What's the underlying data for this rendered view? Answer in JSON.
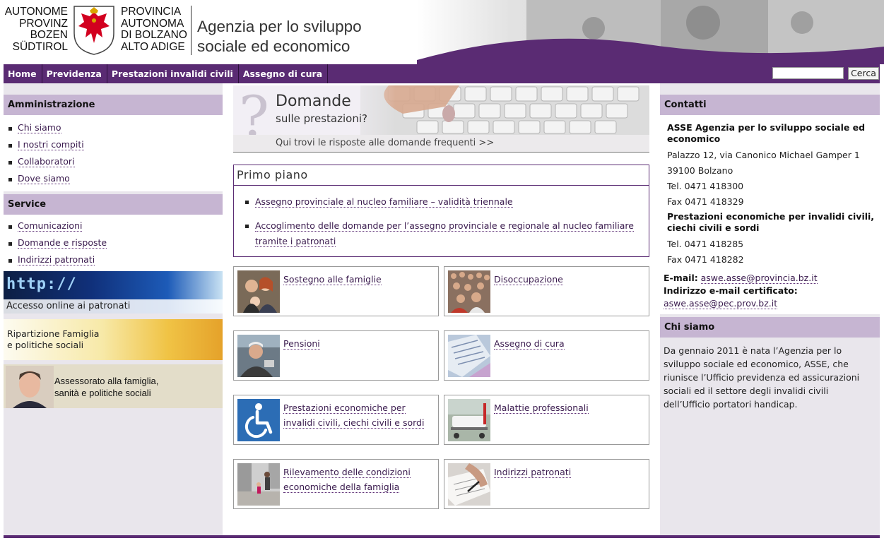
{
  "header": {
    "logo_left_lines": [
      "AUTONOME",
      "PROVINZ",
      "BOZEN",
      "SÜDTIROL"
    ],
    "logo_right_lines": [
      "PROVINCIA",
      "AUTONOMA",
      "DI BOLZANO",
      "ALTO ADIGE"
    ],
    "agency_line1": "Agenzia per lo sviluppo",
    "agency_line2": "sociale ed economico"
  },
  "nav": {
    "items": [
      "Home",
      "Previdenza",
      "Prestazioni invalidi civili",
      "Assegno di cura"
    ],
    "search_value": "",
    "search_button": "Cerca"
  },
  "left": {
    "admin_title": "Amministrazione",
    "admin_links": [
      "Chi siamo",
      "I nostri compiti",
      "Collaboratori",
      "Dove siamo"
    ],
    "service_title": "Service",
    "service_links": [
      "Comunicazioni",
      "Domande e risposte",
      "Indirizzi patronati"
    ],
    "banner_http_text": "http://",
    "banner_http_caption": "Accesso online ai patronati",
    "banner_family_line1": "Ripartizione Famiglia",
    "banner_family_line2": "e politiche sociali",
    "banner_assessor_line1": "Assessorato alla famiglia,",
    "banner_assessor_line2": "sanità e politiche sociali"
  },
  "center": {
    "faq_title": "Domande",
    "faq_sub": "sulle prestazioni?",
    "faq_link": "Qui trovi le risposte alle domande frequenti >>",
    "primo_title": "Primo piano",
    "primo_items": [
      "Assegno provinciale al nucleo familiare – validità triennale",
      "Accoglimento delle domande per l’assegno provinciale e regionale al nucleo familiare tramite i patronati"
    ],
    "tiles": [
      {
        "label": "Sostegno alle famiglie"
      },
      {
        "label": "Disoccupazione"
      },
      {
        "label": "Pensioni"
      },
      {
        "label": "Assegno di cura"
      },
      {
        "label": "Prestazioni economiche per invalidi civili, ciechi civili e sordi"
      },
      {
        "label": "Malattie professionali"
      },
      {
        "label": "Rilevamento delle condizioni economiche della famiglia"
      },
      {
        "label": "Indirizzi patronati"
      }
    ]
  },
  "right": {
    "contacts_title": "Contatti",
    "org_name": "ASSE Agenzia per lo sviluppo sociale ed economico",
    "address1": "Palazzo 12, via Canonico Michael Gamper 1",
    "address2": "39100 Bolzano",
    "tel1": "Tel. 0471 418300",
    "fax1": "Fax 0471 418329",
    "dept_name": "Prestazioni economiche per invalidi civili, ciechi civili e sordi",
    "tel2": "Tel. 0471 418285",
    "fax2": "Fax 0471 418282",
    "email_label": "E-mail:",
    "email": "aswe.asse@provincia.bz.it",
    "pec_label": "Indirizzo e-mail certificato:",
    "pec": "aswe.asse@pec.prov.bz.it",
    "chi_title": "Chi siamo",
    "chi_text": "Da gennaio 2011 è nata l’Agenzia per lo sviluppo sociale ed economico, ASSE, che riunisce l’Ufficio previdenza ed assicurazioni sociali ed il settore degli invalidi civili dell’Ufficio portatori handicap."
  },
  "colors": {
    "brand_purple": "#5a2b73",
    "section_header": "#c6b5d2",
    "sidebar_bg": "#e9e6ec",
    "coat_red": "#d2001f"
  }
}
